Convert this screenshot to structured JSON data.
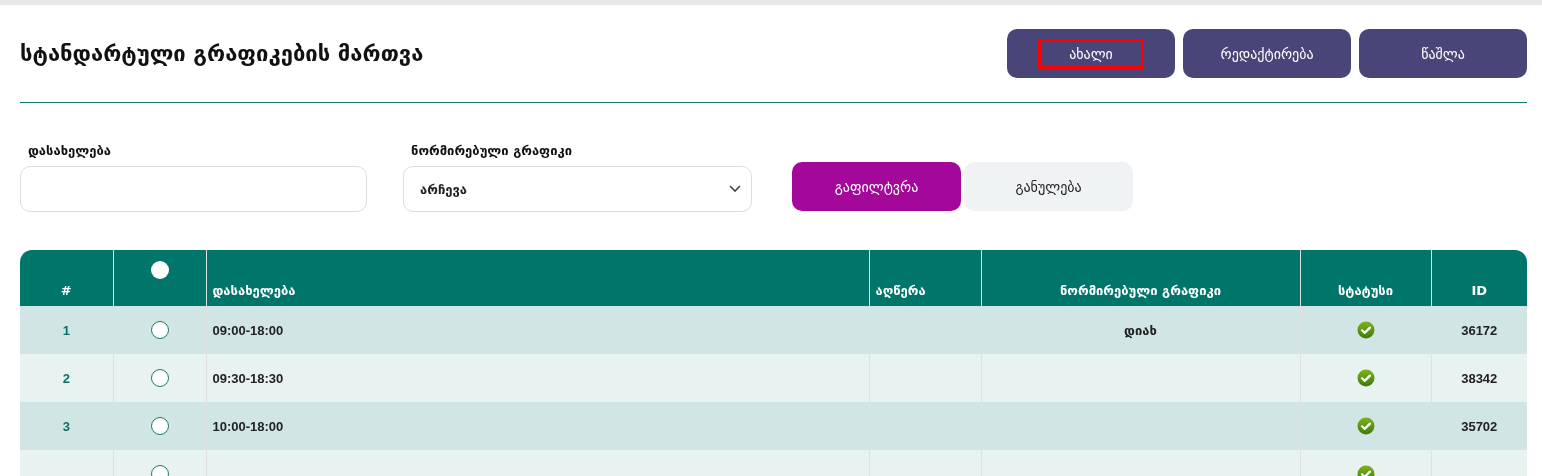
{
  "page": {
    "title": "სტანდარტული გრაფიკების მართვა"
  },
  "actions": [
    {
      "label": "ახალი",
      "highlighted": true
    },
    {
      "label": "რედაქტირება",
      "highlighted": false
    },
    {
      "label": "წაშლა",
      "highlighted": false
    }
  ],
  "filters": {
    "name": {
      "label": "დასახელება"
    },
    "schedule": {
      "label": "ნორმირებული გრაფიკი",
      "value": "არჩევა"
    },
    "buttons": [
      {
        "label": "გაფილტვრა",
        "kind": "primary"
      },
      {
        "label": "განულება",
        "kind": "secondary"
      }
    ]
  },
  "table": {
    "columns": [
      "#",
      "",
      "დასახელება",
      "აღწერა",
      "ნორმირებული გრაფიკი",
      "სტატუსი",
      "ID"
    ],
    "select_all": {
      "selected": false
    },
    "rows": [
      {
        "number": "1",
        "selected": false,
        "name": "09:00-18:00",
        "normalized": "დიახ",
        "active": true,
        "id": "36172"
      },
      {
        "number": "2",
        "selected": false,
        "name": "09:30-18:30",
        "active": true,
        "id": "38342"
      },
      {
        "number": "3",
        "selected": false,
        "name": "10:00-18:00",
        "active": true,
        "id": "35702"
      },
      {
        "selected": false,
        "active": true
      }
    ]
  }
}
